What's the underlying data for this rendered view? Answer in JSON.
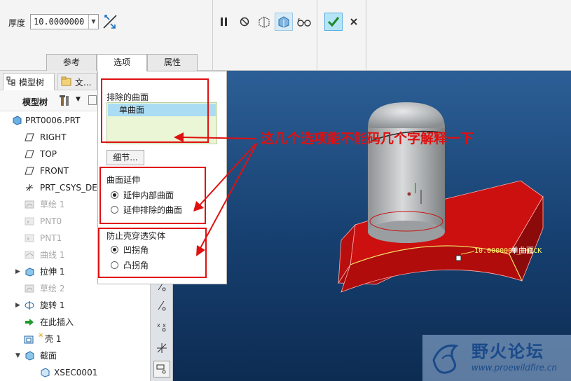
{
  "dashboard": {
    "thickness_label": "厚度",
    "thickness_value": "10.0000000"
  },
  "tabs": [
    {
      "label": "参考"
    },
    {
      "label": "选项"
    },
    {
      "label": "属性"
    }
  ],
  "model_tree": {
    "tab_model": "模型树",
    "tab_files": "文...",
    "toolbar_label": "模型树",
    "items": [
      {
        "label": "PRT0006.PRT"
      },
      {
        "label": "RIGHT"
      },
      {
        "label": "TOP"
      },
      {
        "label": "FRONT"
      },
      {
        "label": "PRT_CSYS_DEF"
      },
      {
        "label": "草绘 1"
      },
      {
        "label": "PNT0"
      },
      {
        "label": "PNT1"
      },
      {
        "label": "曲线 1"
      },
      {
        "label": "拉伸 1"
      },
      {
        "label": "草绘 2"
      },
      {
        "label": "旋转 1"
      },
      {
        "label": "在此插入"
      },
      {
        "label": "壳 1"
      },
      {
        "label": "截面"
      },
      {
        "label": "XSEC0001"
      }
    ]
  },
  "options_panel": {
    "excluded_title": "排除的曲面",
    "excluded_item": "单曲面",
    "detail_button": "细节...",
    "extension_title": "曲面延伸",
    "extension_options": [
      {
        "label": "延伸内部曲面",
        "selected": true
      },
      {
        "label": "延伸排除的曲面",
        "selected": false
      }
    ],
    "prevent_title": "防止壳穿透实体",
    "prevent_options": [
      {
        "label": "凹拐角",
        "selected": true
      },
      {
        "label": "凸拐角",
        "selected": false
      }
    ]
  },
  "viewport": {
    "dimension_label": "10.0000000_THICK",
    "surface_label": "单曲面"
  },
  "annotation": {
    "text": "这几个选项能不能码几个字解释一下",
    "color": "#e01010"
  },
  "watermark": {
    "title": "野火论坛",
    "url": "www.proewildfire.cn"
  },
  "colors": {
    "accent_red": "#e01010",
    "viewport_blue": "#1e4b7e",
    "part_red": "#cc1010",
    "list_bg": "#eaf6d6",
    "selected_bg": "#aadcf3"
  }
}
